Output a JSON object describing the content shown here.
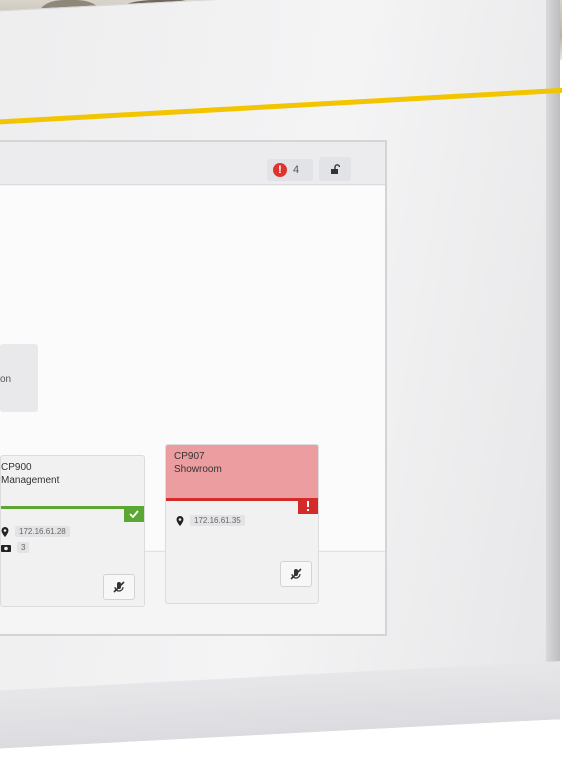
{
  "header": {
    "alert_count": "4",
    "alert_icon_glyph": "!"
  },
  "tile": {
    "label": "on"
  },
  "cards": [
    {
      "id": "CP900",
      "name": "Management",
      "status": "ok",
      "status_color": "#5aa832",
      "ip": "172.16.61.28",
      "count": "3"
    },
    {
      "id": "CP907",
      "name": "Showroom",
      "status": "alert",
      "status_color": "#d42a2a",
      "header_color": "#ec9da0",
      "ip": "172.16.61.35"
    }
  ],
  "colors": {
    "accent_yellow": "#f2c500",
    "alert_red": "#e0332b",
    "ok_green": "#5aa832"
  },
  "icons": {
    "alert": "exclamation-circle-icon",
    "lock": "unlock-icon",
    "location": "map-pin-icon",
    "camera": "camera-icon",
    "mute": "mic-off-icon",
    "check": "check-icon",
    "warning": "exclamation-icon"
  }
}
